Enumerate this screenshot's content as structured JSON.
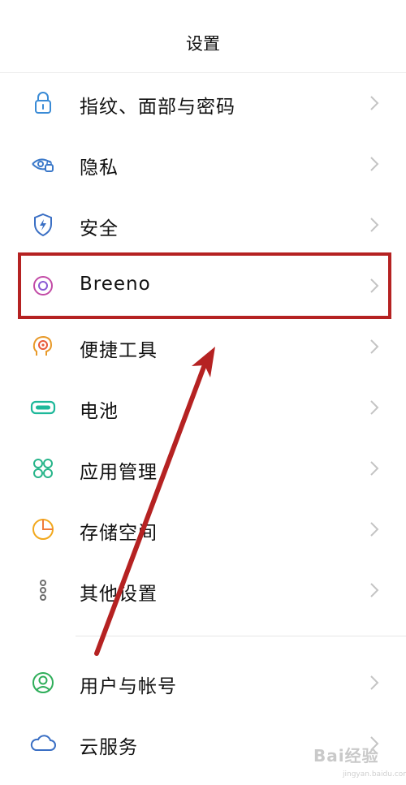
{
  "header": {
    "title": "设置"
  },
  "settings": {
    "items": [
      {
        "label": "指纹、面部与密码",
        "icon": "lock-icon",
        "color": "#3a8bd6"
      },
      {
        "label": "隐私",
        "icon": "eye-lock-icon",
        "color": "#3a78c9"
      },
      {
        "label": "安全",
        "icon": "shield-bolt-icon",
        "color": "#3a6fc4"
      },
      {
        "label": "Breeno",
        "icon": "breeno-ring-icon",
        "color": "#c24aa6"
      },
      {
        "label": "便捷工具",
        "icon": "head-target-icon",
        "color": "#e89a2a"
      },
      {
        "label": "电池",
        "icon": "battery-icon",
        "color": "#1db89a"
      },
      {
        "label": "应用管理",
        "icon": "app-grid-icon",
        "color": "#27b58a"
      },
      {
        "label": "存储空间",
        "icon": "pie-storage-icon",
        "color": "#f2a81d"
      },
      {
        "label": "其他设置",
        "icon": "dots-vertical-icon",
        "color": "#6d6d6d"
      },
      {
        "label": "用户与帐号",
        "icon": "user-circle-icon",
        "color": "#2fae5a"
      },
      {
        "label": "云服务",
        "icon": "cloud-icon",
        "color": "#3a6fc4"
      }
    ]
  },
  "annotation": {
    "highlight_color": "#b52222",
    "highlighted_item": "Breeno"
  },
  "watermark": {
    "text": "Bai经验",
    "sub": "jingyan.baidu.com"
  }
}
